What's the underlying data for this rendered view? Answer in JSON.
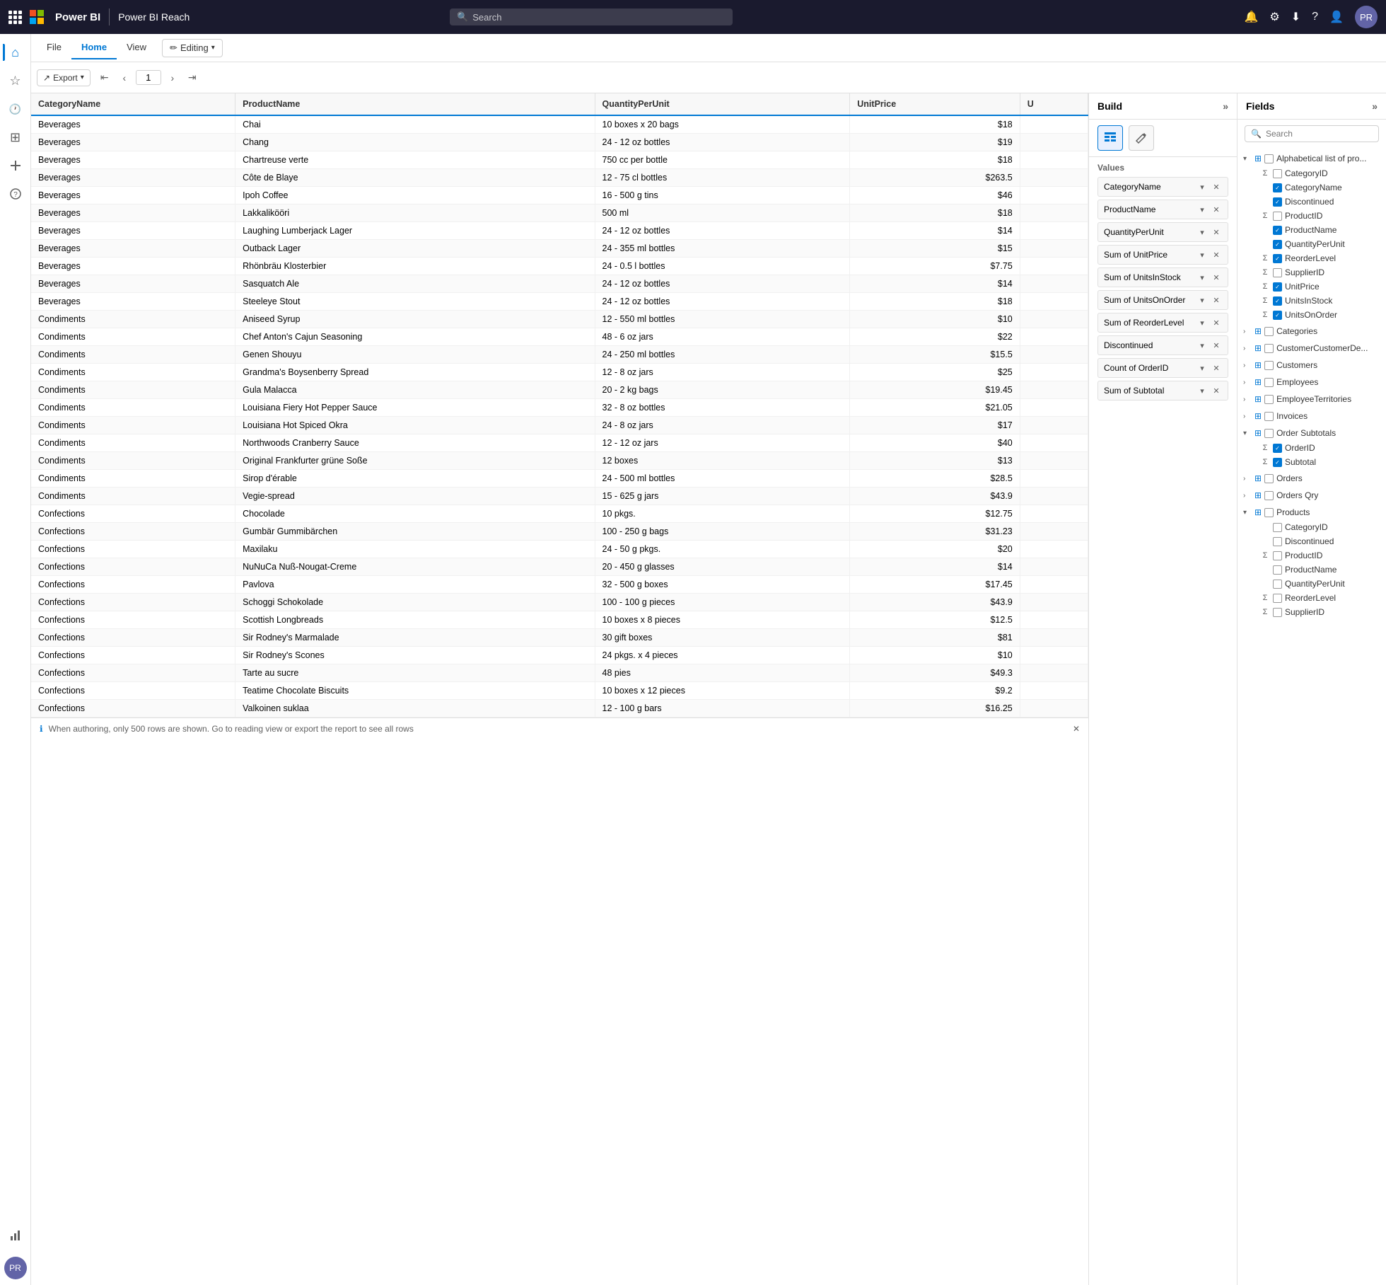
{
  "topnav": {
    "app_name": "Power BI",
    "app_subtitle": "Power BI Reach",
    "search_placeholder": "Search"
  },
  "ribbon": {
    "tabs": [
      "File",
      "Home",
      "View"
    ],
    "active_tab": "Home",
    "editing_label": "Editing"
  },
  "toolbar": {
    "export_label": "Export",
    "page_number": "1"
  },
  "table": {
    "columns": [
      "CategoryName",
      "ProductName",
      "QuantityPerUnit",
      "UnitPrice",
      "U"
    ],
    "rows": [
      [
        "Beverages",
        "Chai",
        "10 boxes x 20 bags",
        "$18",
        ""
      ],
      [
        "Beverages",
        "Chang",
        "24 - 12 oz bottles",
        "$19",
        ""
      ],
      [
        "Beverages",
        "Chartreuse verte",
        "750 cc per bottle",
        "$18",
        ""
      ],
      [
        "Beverages",
        "Côte de Blaye",
        "12 - 75 cl bottles",
        "$263.5",
        ""
      ],
      [
        "Beverages",
        "Ipoh Coffee",
        "16 - 500 g tins",
        "$46",
        ""
      ],
      [
        "Beverages",
        "Lakkalikööri",
        "500 ml",
        "$18",
        ""
      ],
      [
        "Beverages",
        "Laughing Lumberjack Lager",
        "24 - 12 oz bottles",
        "$14",
        ""
      ],
      [
        "Beverages",
        "Outback Lager",
        "24 - 355 ml bottles",
        "$15",
        ""
      ],
      [
        "Beverages",
        "Rhönbräu Klosterbier",
        "24 - 0.5 l bottles",
        "$7.75",
        ""
      ],
      [
        "Beverages",
        "Sasquatch Ale",
        "24 - 12 oz bottles",
        "$14",
        ""
      ],
      [
        "Beverages",
        "Steeleye Stout",
        "24 - 12 oz bottles",
        "$18",
        ""
      ],
      [
        "Condiments",
        "Aniseed Syrup",
        "12 - 550 ml bottles",
        "$10",
        ""
      ],
      [
        "Condiments",
        "Chef Anton's Cajun Seasoning",
        "48 - 6 oz jars",
        "$22",
        ""
      ],
      [
        "Condiments",
        "Genen Shouyu",
        "24 - 250 ml bottles",
        "$15.5",
        ""
      ],
      [
        "Condiments",
        "Grandma's Boysenberry Spread",
        "12 - 8 oz jars",
        "$25",
        ""
      ],
      [
        "Condiments",
        "Gula Malacca",
        "20 - 2 kg bags",
        "$19.45",
        ""
      ],
      [
        "Condiments",
        "Louisiana Fiery Hot Pepper Sauce",
        "32 - 8 oz bottles",
        "$21.05",
        ""
      ],
      [
        "Condiments",
        "Louisiana Hot Spiced Okra",
        "24 - 8 oz jars",
        "$17",
        ""
      ],
      [
        "Condiments",
        "Northwoods Cranberry Sauce",
        "12 - 12 oz jars",
        "$40",
        ""
      ],
      [
        "Condiments",
        "Original Frankfurter grüne Soße",
        "12 boxes",
        "$13",
        ""
      ],
      [
        "Condiments",
        "Sirop d'érable",
        "24 - 500 ml bottles",
        "$28.5",
        ""
      ],
      [
        "Condiments",
        "Vegie-spread",
        "15 - 625 g jars",
        "$43.9",
        ""
      ],
      [
        "Confections",
        "Chocolade",
        "10 pkgs.",
        "$12.75",
        ""
      ],
      [
        "Confections",
        "Gumbär Gummibärchen",
        "100 - 250 g bags",
        "$31.23",
        ""
      ],
      [
        "Confections",
        "Maxilaku",
        "24 - 50 g pkgs.",
        "$20",
        ""
      ],
      [
        "Confections",
        "NuNuCa Nuß-Nougat-Creme",
        "20 - 450 g glasses",
        "$14",
        ""
      ],
      [
        "Confections",
        "Pavlova",
        "32 - 500 g boxes",
        "$17.45",
        ""
      ],
      [
        "Confections",
        "Schoggi Schokolade",
        "100 - 100 g pieces",
        "$43.9",
        ""
      ],
      [
        "Confections",
        "Scottish Longbreads",
        "10 boxes x 8 pieces",
        "$12.5",
        ""
      ],
      [
        "Confections",
        "Sir Rodney's Marmalade",
        "30 gift boxes",
        "$81",
        ""
      ],
      [
        "Confections",
        "Sir Rodney's Scones",
        "24 pkgs. x 4 pieces",
        "$10",
        ""
      ],
      [
        "Confections",
        "Tarte au sucre",
        "48 pies",
        "$49.3",
        ""
      ],
      [
        "Confections",
        "Teatime Chocolate Biscuits",
        "10 boxes x 12 pieces",
        "$9.2",
        ""
      ],
      [
        "Confections",
        "Valkoinen suklaa",
        "12 - 100 g bars",
        "$16.25",
        ""
      ]
    ]
  },
  "build_panel": {
    "title": "Build",
    "fields_label": "Fields",
    "values_label": "Values",
    "values_items": [
      "CategoryName",
      "ProductName",
      "QuantityPerUnit",
      "Sum of UnitPrice",
      "Sum of UnitsInStock",
      "Sum of UnitsOnOrder",
      "Sum of ReorderLevel",
      "Discontinued",
      "Count of OrderID",
      "Sum of Subtotal"
    ]
  },
  "fields_panel": {
    "title": "Fields",
    "search_placeholder": "Search",
    "expand_label": ">>",
    "groups": [
      {
        "name": "Alphabetical list of pro...",
        "expanded": true,
        "icon": "table",
        "items": [
          {
            "label": "CategoryID",
            "checked": false,
            "sigma": true
          },
          {
            "label": "CategoryName",
            "checked": true,
            "sigma": false
          },
          {
            "label": "Discontinued",
            "checked": true,
            "sigma": false
          },
          {
            "label": "ProductID",
            "checked": false,
            "sigma": true
          },
          {
            "label": "ProductName",
            "checked": true,
            "sigma": false
          },
          {
            "label": "QuantityPerUnit",
            "checked": true,
            "sigma": false
          },
          {
            "label": "ReorderLevel",
            "checked": true,
            "sigma": true
          },
          {
            "label": "SupplierID",
            "checked": false,
            "sigma": true
          },
          {
            "label": "UnitPrice",
            "checked": true,
            "sigma": true
          },
          {
            "label": "UnitsInStock",
            "checked": true,
            "sigma": true
          },
          {
            "label": "UnitsOnOrder",
            "checked": true,
            "sigma": true
          }
        ]
      },
      {
        "name": "Categories",
        "expanded": false,
        "icon": "table",
        "items": []
      },
      {
        "name": "CustomerCustomerDe...",
        "expanded": false,
        "icon": "table",
        "items": []
      },
      {
        "name": "Customers",
        "expanded": false,
        "icon": "table",
        "items": []
      },
      {
        "name": "Employees",
        "expanded": false,
        "icon": "table",
        "items": []
      },
      {
        "name": "EmployeeTerritories",
        "expanded": false,
        "icon": "table",
        "items": []
      },
      {
        "name": "Invoices",
        "expanded": false,
        "icon": "table",
        "items": []
      },
      {
        "name": "Order Subtotals",
        "expanded": true,
        "icon": "table",
        "items": [
          {
            "label": "OrderID",
            "checked": true,
            "sigma": true
          },
          {
            "label": "Subtotal",
            "checked": true,
            "sigma": true
          }
        ]
      },
      {
        "name": "Orders",
        "expanded": false,
        "icon": "table",
        "items": []
      },
      {
        "name": "Orders Qry",
        "expanded": false,
        "icon": "table",
        "items": []
      },
      {
        "name": "Products",
        "expanded": true,
        "icon": "table",
        "items": [
          {
            "label": "CategoryID",
            "checked": false,
            "sigma": false
          },
          {
            "label": "Discontinued",
            "checked": false,
            "sigma": false
          },
          {
            "label": "ProductID",
            "checked": false,
            "sigma": true
          },
          {
            "label": "ProductName",
            "checked": false,
            "sigma": false
          },
          {
            "label": "QuantityPerUnit",
            "checked": false,
            "sigma": false
          },
          {
            "label": "ReorderLevel",
            "checked": false,
            "sigma": true
          },
          {
            "label": "SupplierID",
            "checked": false,
            "sigma": true
          }
        ]
      }
    ]
  },
  "bottom_bar": {
    "message": "When authoring, only 500 rows are shown. Go to reading view or export the report to see all rows"
  },
  "sidebar_icons": [
    {
      "name": "home-icon",
      "glyph": "⌂"
    },
    {
      "name": "favorite-icon",
      "glyph": "☆"
    },
    {
      "name": "recent-icon",
      "glyph": "🕐"
    },
    {
      "name": "apps-icon",
      "glyph": "⊞"
    },
    {
      "name": "create-icon",
      "glyph": "+"
    },
    {
      "name": "learn-icon",
      "glyph": "?"
    },
    {
      "name": "metrics-icon",
      "glyph": "◈"
    }
  ]
}
